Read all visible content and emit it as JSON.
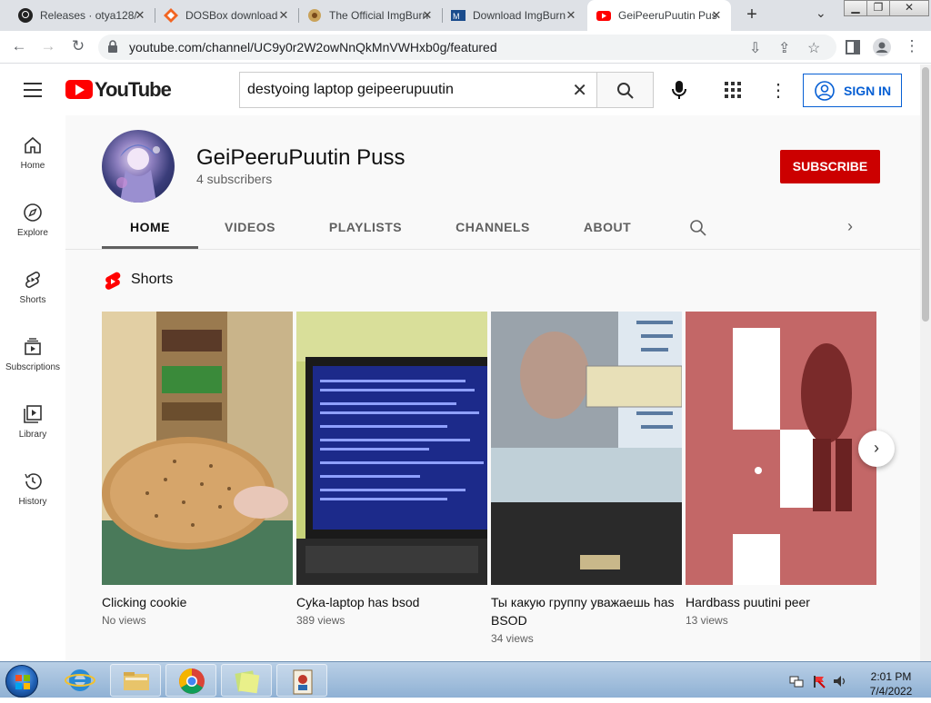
{
  "browser": {
    "tabs": [
      {
        "title": "Releases · otya128/",
        "icon": "github-icon"
      },
      {
        "title": "DOSBox download",
        "icon": "sourceforge-icon"
      },
      {
        "title": "The Official ImgBurn",
        "icon": "imgburn-icon"
      },
      {
        "title": "Download ImgBurn",
        "icon": "majorgeeks-icon"
      },
      {
        "title": "GeiPeeruPuutin Pus",
        "icon": "youtube-icon"
      }
    ],
    "url": "youtube.com/channel/UC9y0r2W2owNnQkMnVWHxb0g/featured"
  },
  "youtube": {
    "logo_text": "YouTube",
    "search_value": "destyoing laptop geipeerupuutin",
    "signin_label": "SIGN IN",
    "accent": "#ff0000"
  },
  "leftnav": [
    {
      "label": "Home",
      "icon": "home-icon"
    },
    {
      "label": "Explore",
      "icon": "compass-icon"
    },
    {
      "label": "Shorts",
      "icon": "shorts-icon"
    },
    {
      "label": "Subscriptions",
      "icon": "subscriptions-icon"
    },
    {
      "label": "Library",
      "icon": "library-icon"
    },
    {
      "label": "History",
      "icon": "history-icon"
    }
  ],
  "channel": {
    "name": "GeiPeeruPuutin Puss",
    "subscribers": "4 subscribers",
    "subscribe_label": "SUBSCRIBE",
    "tabs": [
      "HOME",
      "VIDEOS",
      "PLAYLISTS",
      "CHANNELS",
      "ABOUT"
    ],
    "active_tab": "HOME"
  },
  "shorts": {
    "title": "Shorts",
    "items": [
      {
        "title": "Clicking cookie",
        "views": "No views"
      },
      {
        "title": "Cyka-laptop has bsod",
        "views": "389 views"
      },
      {
        "title": "Ты какую группу уважаешь has BSOD",
        "views": "34 views"
      },
      {
        "title": "Hardbass puutini peer",
        "views": "13 views"
      }
    ]
  },
  "taskbar": {
    "time": "2:01 PM",
    "date": "7/4/2022"
  }
}
